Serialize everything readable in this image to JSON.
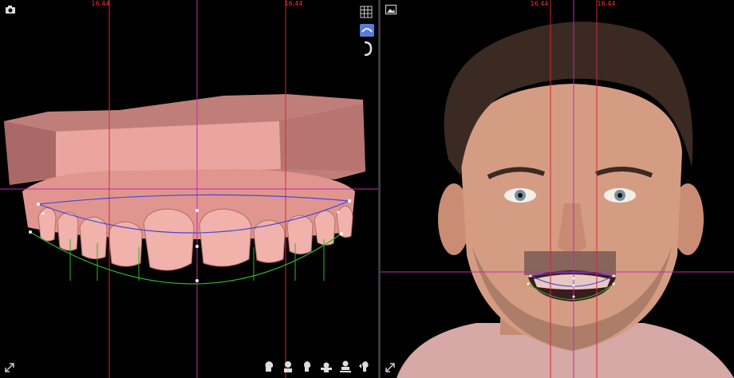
{
  "left_viewport": {
    "measurements": [
      "16,44",
      "16,44"
    ],
    "toolbar_icons": [
      "camera-icon",
      "grid-display-icon",
      "texture-display-icon",
      "articulator-icon"
    ],
    "collapse_icon": "collapse-arrows-icon",
    "view_icons": [
      "head-profile-view-icon",
      "head-front-view-icon",
      "head-three-quarter-view-icon",
      "head-top-view-icon",
      "head-bottom-view-icon",
      "head-side-view-icon"
    ]
  },
  "right_viewport": {
    "measurements": [
      "16,44",
      "16,44"
    ],
    "toolbar_icons": [
      "image-icon"
    ],
    "collapse_icon": "collapse-arrows-icon"
  },
  "colors": {
    "guide_red": "#d8263a",
    "guide_magenta": "#c02aa8",
    "tooth_pink": "#e8a19c",
    "arch_green": "#2fb52f",
    "arch_blue": "#4a44d8"
  }
}
